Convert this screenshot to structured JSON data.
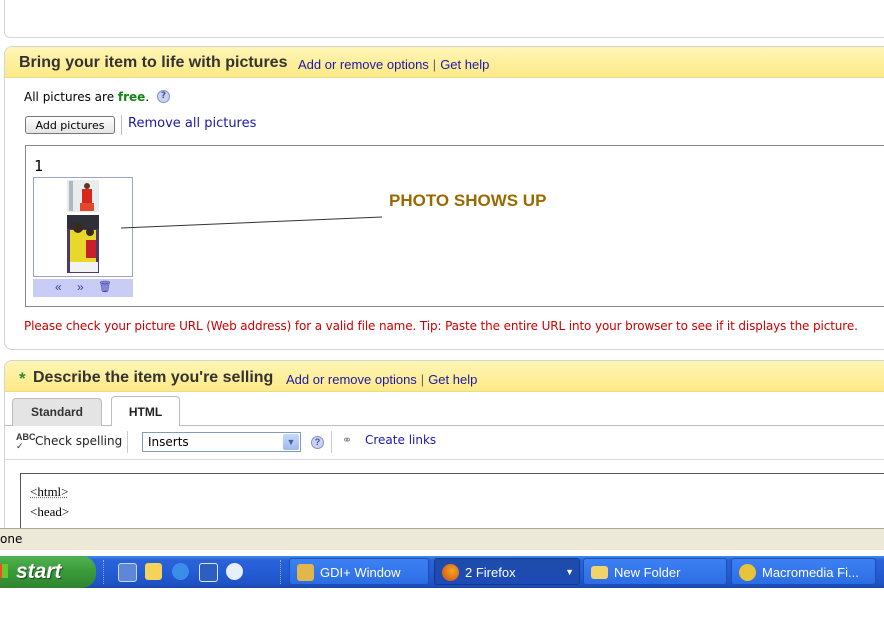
{
  "pictures": {
    "title": "Bring your item to life with pictures",
    "link_options": "Add or remove options",
    "link_help": "Get help",
    "free_prefix": "All pictures are ",
    "free_word": "free",
    "free_suffix": ".",
    "add_button": "Add pictures",
    "remove_all": "Remove all pictures",
    "slot_number": "1",
    "annotation": "PHOTO SHOWS UP",
    "error_message": "Please check your picture URL (Web address) for a valid file name. Tip: Paste the entire URL into your browser to see if it displays the picture.",
    "thumb_controls": [
      "«",
      "»",
      "🗑"
    ]
  },
  "describe": {
    "asterisk": "*",
    "title": "Describe the item you're selling",
    "link_options": "Add or remove options",
    "link_help": "Get help",
    "tabs": [
      {
        "label": "Standard",
        "active": false
      },
      {
        "label": "HTML",
        "active": true
      }
    ],
    "toolbar": {
      "spell": "Check spelling",
      "inserts_value": "Inserts",
      "create_links": "Create links"
    },
    "code_lines": [
      "<html>",
      "<head>"
    ]
  },
  "status": {
    "text": "one"
  },
  "taskbar": {
    "start": "start",
    "buttons": [
      {
        "label": "GDI+ Window",
        "active": false
      },
      {
        "label": "2 Firefox",
        "active": true
      },
      {
        "label": "New Folder",
        "active": false
      },
      {
        "label": "Macromedia Fi...",
        "active": false
      }
    ]
  },
  "colors": {
    "free_green": "#118811",
    "error_red": "#cc0000",
    "annotation_brown": "#9a6a00",
    "asterisk_green": "#2e8b2e"
  }
}
